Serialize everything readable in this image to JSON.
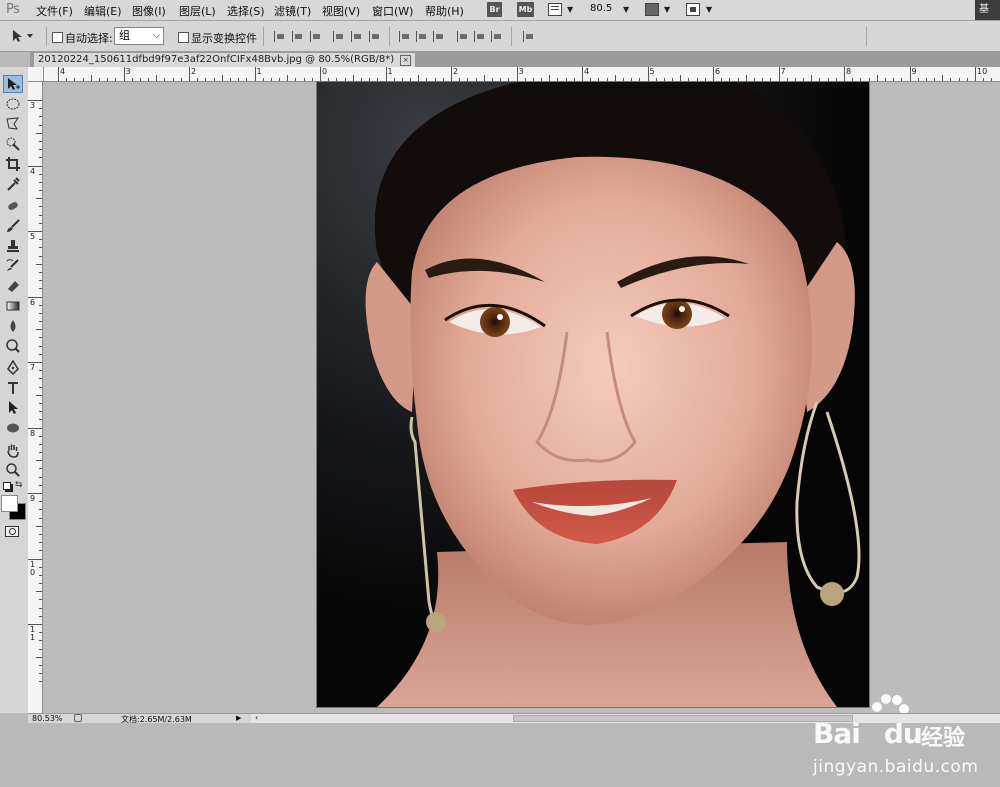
{
  "app": {
    "logo": "Ps"
  },
  "menu": [
    {
      "label": "文件(F)"
    },
    {
      "label": "编辑(E)"
    },
    {
      "label": "图像(I)"
    },
    {
      "label": "图层(L)"
    },
    {
      "label": "选择(S)"
    },
    {
      "label": "滤镜(T)"
    },
    {
      "label": "视图(V)"
    },
    {
      "label": "窗口(W)"
    },
    {
      "label": "帮助(H)"
    }
  ],
  "appbar": {
    "bridge_label": "Br",
    "minibridge_label": "Mb",
    "zoom_value": "80.5",
    "workspace_label": "基"
  },
  "options": {
    "auto_select_label": "自动选择:",
    "auto_select_value": "组",
    "show_transform_label": "显示变换控件"
  },
  "document": {
    "tab_title": "20120224_150611dfbd9f97e3af22OnfCIFx48Bvb.jpg @ 80.5%(RGB/8*)",
    "close_symbol": "×"
  },
  "rulers": {
    "top_labels": [
      "4",
      "3",
      "2",
      "1",
      "0",
      "1",
      "2",
      "3",
      "4",
      "5",
      "6",
      "7",
      "8",
      "9",
      "10"
    ],
    "left_labels": [
      "3",
      "4",
      "5",
      "6",
      "7",
      "8",
      "9",
      "1\n0",
      "1\n1"
    ]
  },
  "status": {
    "zoom": "80.53%",
    "doc_info": "文档:2.65M/2.63M"
  },
  "watermark": {
    "brand": "Bai",
    "brand_du": "du",
    "chinese": "经验",
    "url": "jingyan.baidu.com"
  }
}
